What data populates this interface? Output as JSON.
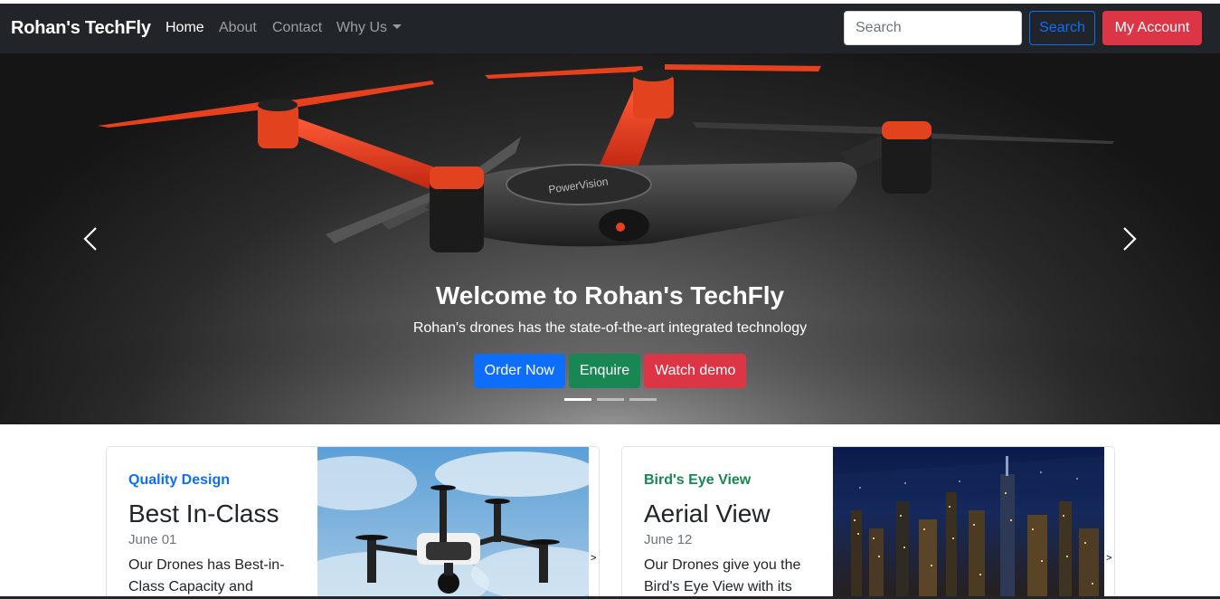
{
  "navbar": {
    "brand": "Rohan's TechFly",
    "links": [
      {
        "label": "Home",
        "active": true
      },
      {
        "label": "About",
        "active": false
      },
      {
        "label": "Contact",
        "active": false
      },
      {
        "label": "Why Us",
        "active": false,
        "dropdown": true
      }
    ],
    "search_placeholder": "Search",
    "search_button": "Search",
    "account_button": "My Account"
  },
  "carousel": {
    "title": "Welcome to Rohan's TechFly",
    "subtitle": "Rohan's drones has the state-of-the-art integrated technology",
    "buttons": [
      "Order Now",
      "Enquire",
      "Watch demo"
    ],
    "slide_count": 3,
    "active_slide": 1,
    "drone_label": "PowerVision"
  },
  "cards": [
    {
      "category": "Quality Design",
      "category_color": "#0d6efd",
      "title": "Best In-Class",
      "date": "June 01",
      "text": "Our Drones has Best-in-Class Capacity and"
    },
    {
      "category": "Bird's Eye View",
      "category_color": "#198754",
      "title": "Aerial View",
      "date": "June 12",
      "text": "Our Drones give you the Bird's Eye View with its"
    }
  ],
  "colors": {
    "navbar_bg": "#212529",
    "primary": "#0d6efd",
    "success": "#198754",
    "danger": "#dc3545"
  }
}
